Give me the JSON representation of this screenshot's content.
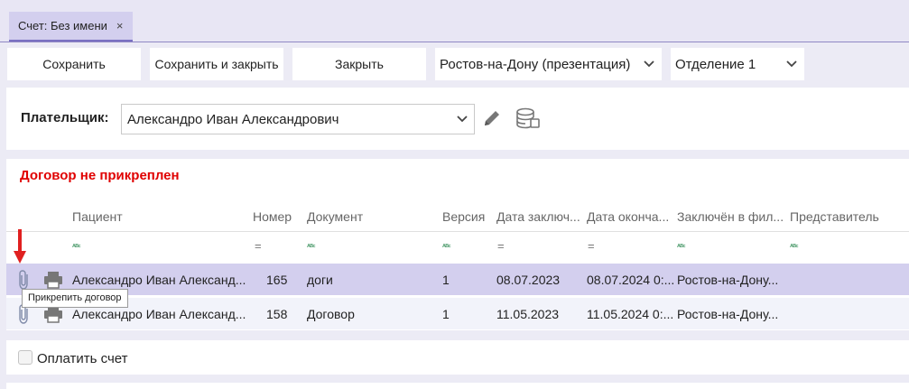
{
  "tab": {
    "title": "Счет: Без имени",
    "close": "×"
  },
  "toolbar": {
    "save": "Сохранить",
    "save_close": "Сохранить и закрыть",
    "close": "Закрыть",
    "branch_select": "Ростов-на-Дону (презентация)",
    "department_select": "Отделение 1"
  },
  "payer": {
    "label": "Плательщик:",
    "value": "Александро Иван Александрович"
  },
  "contract": {
    "warning": "Договор не прикреплен",
    "columns": [
      "Пациент",
      "Номер",
      "Документ",
      "Версия",
      "Дата заключ...",
      "Дата оконча...",
      "Заключён в фил...",
      "Представитель"
    ],
    "filter_abc": "ᴬᴮᶜ",
    "filter_eq": "=",
    "rows": [
      {
        "patient": "Александро Иван Александ...",
        "number": "165",
        "document": "доги",
        "version": "1",
        "date_start": "08.07.2023",
        "date_end": "08.07.2024 0:...",
        "branch": "Ростов-на-Дону..."
      },
      {
        "patient": "Александро Иван Александ...",
        "number": "158",
        "document": "Договор",
        "version": "1",
        "date_start": "11.05.2023",
        "date_end": "11.05.2024 0:...",
        "branch": "Ростов-на-Дону..."
      }
    ],
    "tooltip": "Прикрепить договор"
  },
  "payment": {
    "label": "Оплатить счет"
  },
  "colors": {
    "accent": "#d3cfee",
    "warning": "#e00000",
    "annotation": "#e02020"
  }
}
